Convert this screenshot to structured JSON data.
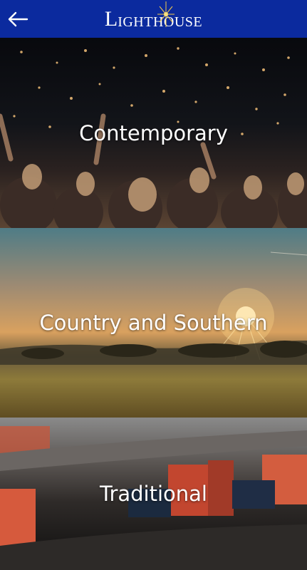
{
  "header": {
    "back_icon": "arrow-left-icon",
    "logo_initial": "L",
    "logo_rest": "IGHTHOUSE",
    "background": "#0b2a9e"
  },
  "tiles": [
    {
      "label": "Contemporary"
    },
    {
      "label": "Country and Southern"
    },
    {
      "label": "Traditional"
    }
  ]
}
